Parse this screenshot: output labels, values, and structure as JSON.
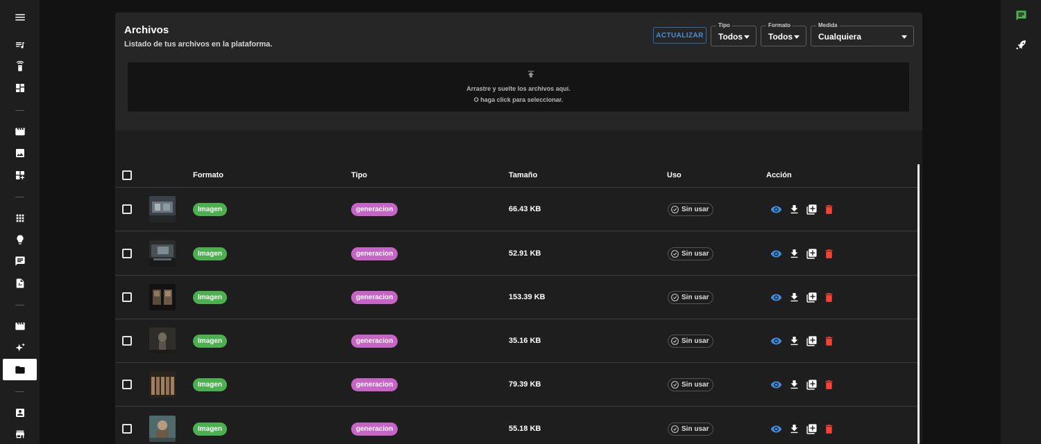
{
  "header": {
    "title": "Archivos",
    "subtitle": "Listado de tus archivos en la plataforma.",
    "refresh_label": "ACTUALIZAR"
  },
  "filters": {
    "tipo": {
      "label": "Tipo",
      "value": "Todos"
    },
    "formato": {
      "label": "Formato",
      "value": "Todos"
    },
    "medida": {
      "label": "Medida",
      "value": "Cualquiera"
    }
  },
  "dropzone": {
    "line1": "Arrastre y suelte los archivos aquí.",
    "line2": "O haga click para seleccionar."
  },
  "table": {
    "columns": {
      "formato": "Formato",
      "tipo": "Tipo",
      "tamano": "Tamaño",
      "uso": "Uso",
      "accion": "Acción"
    },
    "rows": [
      {
        "formato": "Imagen",
        "tipo": "generacion",
        "size": "66.43 KB",
        "uso": "Sin usar"
      },
      {
        "formato": "Imagen",
        "tipo": "generacion",
        "size": "52.91 KB",
        "uso": "Sin usar"
      },
      {
        "formato": "Imagen",
        "tipo": "generacion",
        "size": "153.39 KB",
        "uso": "Sin usar"
      },
      {
        "formato": "Imagen",
        "tipo": "generacion",
        "size": "35.16 KB",
        "uso": "Sin usar"
      },
      {
        "formato": "Imagen",
        "tipo": "generacion",
        "size": "79.39 KB",
        "uso": "Sin usar"
      },
      {
        "formato": "Imagen",
        "tipo": "generacion",
        "size": "55.18 KB",
        "uso": "Sin usar"
      }
    ]
  },
  "colors": {
    "accent_blue": "#4a90d9",
    "chip_green": "#4caf50",
    "chip_purple": "#c765c7",
    "delete_red": "#f44336",
    "view_blue": "#3d8ee0",
    "right_rail_green": "#4caf50"
  },
  "icons": {
    "left_rail": [
      "menu-icon",
      "playlist-icon",
      "remote-icon",
      "dashboard-icon",
      "movie-icon",
      "image-icon",
      "widgets-icon",
      "apps-icon",
      "lightbulb-icon",
      "chat-icon",
      "document-icon",
      "movie-icon",
      "sparkles-icon",
      "folder-icon",
      "contact-icon",
      "store-icon"
    ],
    "right_rail": [
      "chat-icon",
      "rocket-icon"
    ],
    "row_actions": [
      "eye-icon",
      "download-icon",
      "add-box-icon",
      "delete-icon"
    ]
  }
}
